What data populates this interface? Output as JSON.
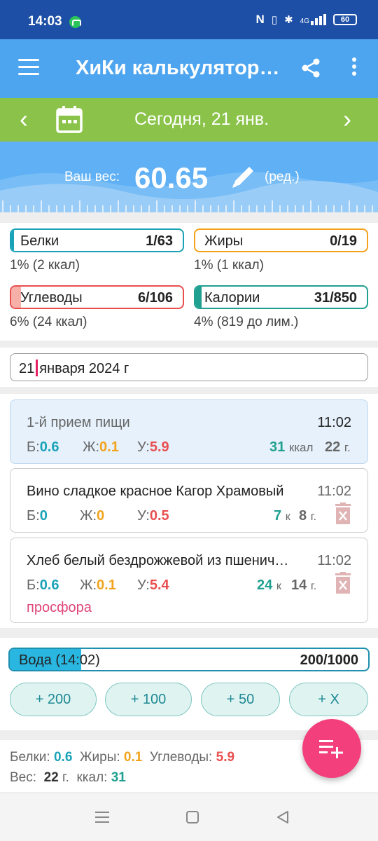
{
  "status": {
    "time": "14:03",
    "network": "4G",
    "battery": "60",
    "icons": [
      "nfc-icon",
      "vibrate-icon",
      "bluetooth-icon",
      "signal-icon"
    ]
  },
  "appbar": {
    "title": "ХиКи калькулятор…"
  },
  "datebar": {
    "date": "Сегодня, 21 янв."
  },
  "weight": {
    "label": "Ваш вес:",
    "value": "60.65",
    "edit": "(ред.)"
  },
  "macros": {
    "protein": {
      "label": "Белки",
      "amount": "1/63",
      "sub": "1% (2 ккал)",
      "fill": 0.016,
      "color": "#1aa3b8"
    },
    "fat": {
      "label": "Жиры",
      "amount": "0/19",
      "sub": "1% (1 ккал)",
      "fill": 0.0,
      "color": "#f2a31b"
    },
    "carbs": {
      "label": "Углеводы",
      "amount": "6/106",
      "sub": "6% (24 ккал)",
      "fill": 0.057,
      "color": "#e94f4f"
    },
    "calories": {
      "label": "Калории",
      "amount": "31/850",
      "sub": "4% (819 до лим.)",
      "fill": 0.036,
      "color": "#20a090"
    }
  },
  "date_input": {
    "value_before_caret": "21",
    "value_after_caret": "января 2024 г"
  },
  "meal": {
    "name": "1-й прием пищи",
    "time": "11:02",
    "p_label": "Б:",
    "p": "0.6",
    "f_label": "Ж:",
    "f": "0.1",
    "c_label": "У:",
    "c": "5.9",
    "kcal": "31",
    "kcal_unit": "ккал",
    "grams": "22",
    "grams_unit": "г."
  },
  "items": [
    {
      "name": "Вино сладкое красное Кагор Храмовый",
      "time": "11:02",
      "p_label": "Б:",
      "p": "0",
      "f_label": "Ж:",
      "f": "0",
      "c_label": "У:",
      "c": "0.5",
      "kcal": "7",
      "kcal_unit": "к",
      "grams": "8",
      "grams_unit": "г.",
      "note": ""
    },
    {
      "name": "Хлеб белый бездрожжевой из пшенич…",
      "time": "11:02",
      "p_label": "Б:",
      "p": "0.6",
      "f_label": "Ж:",
      "f": "0.1",
      "c_label": "У:",
      "c": "5.4",
      "kcal": "24",
      "kcal_unit": "к",
      "grams": "14",
      "grams_unit": "г.",
      "note": "просфора"
    }
  ],
  "water": {
    "label": "Вода (14:02)",
    "amount": "200/1000",
    "fill": 0.2,
    "buttons": [
      "+ 200",
      "+ 100",
      "+ 50",
      "+ X"
    ]
  },
  "totals": {
    "protein_label": "Белки:",
    "protein": "0.6",
    "fat_label": "Жиры:",
    "fat": "0.1",
    "carbs_label": "Углеводы:",
    "carbs": "5.9",
    "weight_label": "Вес:",
    "weight": "22",
    "weight_unit": "г.",
    "kcal_label": "ккал:",
    "kcal": "31"
  },
  "colors": {
    "status_bar": "#1d4fa6",
    "app_bar": "#4da4ef",
    "date_bar": "#8bc34a",
    "fab": "#f33f7c"
  }
}
